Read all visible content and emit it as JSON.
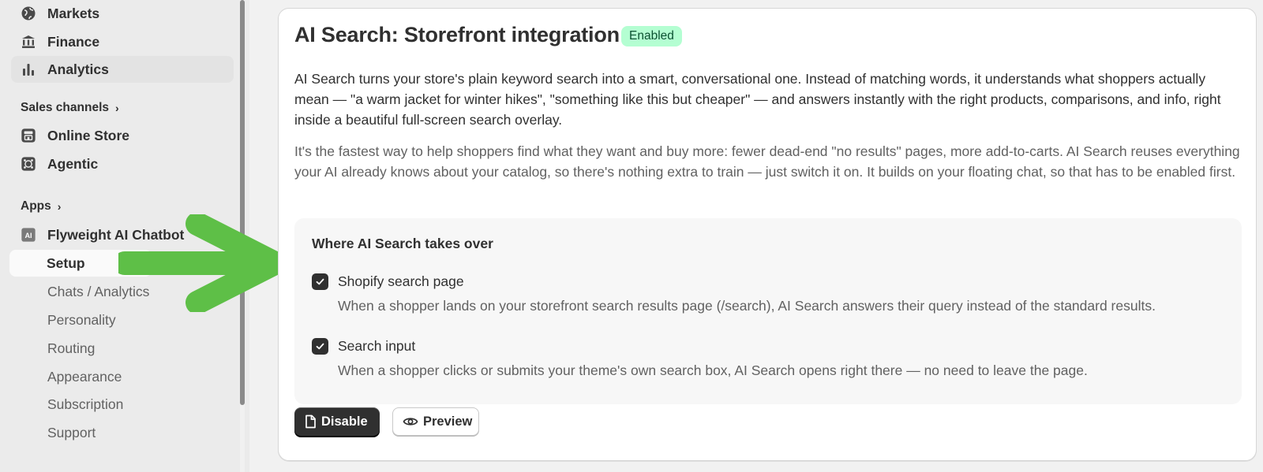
{
  "sidebar": {
    "items": [
      {
        "label": "Markets",
        "icon": "globe-icon"
      },
      {
        "label": "Finance",
        "icon": "bank-icon"
      },
      {
        "label": "Analytics",
        "icon": "bar-chart-icon"
      }
    ],
    "sales_channels": {
      "title": "Sales channels",
      "items": [
        {
          "label": "Online Store",
          "icon": "store-icon"
        },
        {
          "label": "Agentic",
          "icon": "agentic-icon"
        }
      ]
    },
    "apps": {
      "title": "Apps",
      "app": {
        "label": "Flyweight AI Chatbot",
        "icon": "ai-app-icon",
        "icon_text": "AI"
      },
      "sub_items": [
        "Setup",
        "Chats / Analytics",
        "Personality",
        "Routing",
        "Appearance",
        "Subscription",
        "Support"
      ]
    }
  },
  "card": {
    "title": "AI Search: Storefront integration",
    "status_badge": "Enabled",
    "paragraph_1": "AI Search turns your store's plain keyword search into a smart, conversational one. Instead of matching words, it understands what shoppers actually mean — \"a warm jacket for winter hikes\", \"something like this but cheaper\" — and answers instantly with the right products, comparisons, and info, right inside a beautiful full-screen search overlay.",
    "paragraph_2": "It's the fastest way to help shoppers find what they want and buy more: fewer dead-end \"no results\" pages, more add-to-carts. AI Search reuses everything your AI already knows about your catalog, so there's nothing extra to train — just switch it on. It builds on your floating chat, so that has to be enabled first.",
    "panel": {
      "title": "Where AI Search takes over",
      "options": [
        {
          "label": "Shopify search page",
          "help": "When a shopper lands on your storefront search results page (/search), AI Search answers their query instead of the standard results.",
          "checked": true
        },
        {
          "label": "Search input",
          "help": "When a shopper clicks or submits your theme's own search box, AI Search opens right there — no need to leave the page.",
          "checked": true
        }
      ]
    },
    "buttons": {
      "disable": "Disable",
      "preview": "Preview"
    }
  },
  "colors": {
    "accent_arrow": "#5ebf47",
    "badge_bg": "#b4fed2",
    "badge_text": "#0c5132",
    "primary_button": "#303030"
  }
}
